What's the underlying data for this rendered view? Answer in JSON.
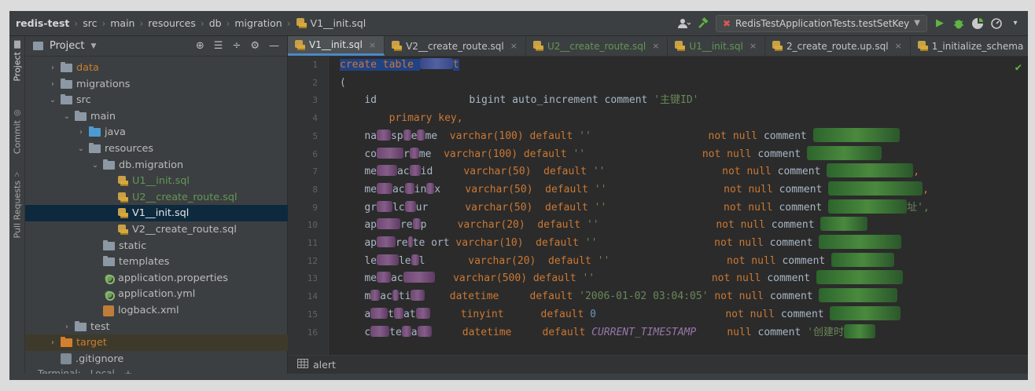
{
  "breadcrumb": {
    "items": [
      "redis-test",
      "src",
      "main",
      "resources",
      "db",
      "migration"
    ],
    "file": "V1__init.sql"
  },
  "run_config": {
    "label": "RedisTestApplicationTests.testSetKey"
  },
  "left_stripe": {
    "tabs": [
      "Project",
      "Commit",
      "Pull Requests"
    ]
  },
  "project_panel": {
    "title": "Project",
    "tree": [
      {
        "label": "data",
        "kind": "folder",
        "arrow": "›",
        "color": "orange"
      },
      {
        "label": "migrations",
        "kind": "folder",
        "arrow": "›",
        "color": ""
      },
      {
        "label": "src",
        "kind": "folder",
        "arrow": "⌄",
        "color": ""
      },
      {
        "label": "main",
        "kind": "folder",
        "arrow": "⌄",
        "color": ""
      },
      {
        "label": "java",
        "kind": "folder-blue",
        "arrow": "›",
        "color": ""
      },
      {
        "label": "resources",
        "kind": "folder",
        "arrow": "⌄",
        "color": ""
      },
      {
        "label": "db.migration",
        "kind": "folder",
        "arrow": "⌄",
        "color": ""
      },
      {
        "label": "U1__init.sql",
        "kind": "sql",
        "arrow": "",
        "color": "green"
      },
      {
        "label": "U2__create_route.sql",
        "kind": "sql",
        "arrow": "",
        "color": "green"
      },
      {
        "label": "V1__init.sql",
        "kind": "sql",
        "arrow": "",
        "color": "white"
      },
      {
        "label": "V2__create_route.sql",
        "kind": "sql",
        "arrow": "",
        "color": ""
      },
      {
        "label": "static",
        "kind": "folder",
        "arrow": "",
        "color": ""
      },
      {
        "label": "templates",
        "kind": "folder",
        "arrow": "",
        "color": ""
      },
      {
        "label": "application.properties",
        "kind": "props",
        "arrow": "",
        "color": ""
      },
      {
        "label": "application.yml",
        "kind": "props",
        "arrow": "",
        "color": ""
      },
      {
        "label": "logback.xml",
        "kind": "xml",
        "arrow": "",
        "color": ""
      },
      {
        "label": "test",
        "kind": "folder",
        "arrow": "›",
        "color": ""
      },
      {
        "label": "target",
        "kind": "folder-orange",
        "arrow": "›",
        "color": "orange"
      },
      {
        "label": ".gitignore",
        "kind": "git",
        "arrow": "",
        "color": ""
      }
    ],
    "terminal": {
      "label": "Terminal:",
      "session": "Local"
    }
  },
  "tabs": [
    {
      "label": "V1__init.sql",
      "active": true,
      "color": ""
    },
    {
      "label": "V2__create_route.sql",
      "active": false,
      "color": ""
    },
    {
      "label": "U2__create_route.sql",
      "active": false,
      "color": "green"
    },
    {
      "label": "U1__init.sql",
      "active": false,
      "color": "green"
    },
    {
      "label": "2_create_route.up.sql",
      "active": false,
      "color": ""
    },
    {
      "label": "1_initialize_schema",
      "active": false,
      "color": ""
    }
  ],
  "editor": {
    "line_numbers": [
      "1",
      "2",
      "3",
      "4",
      "5",
      "6",
      "7",
      "8",
      "9",
      "10",
      "11",
      "12",
      "13",
      "14",
      "15",
      "16"
    ],
    "code": {
      "create": "create",
      "table": "table",
      "open_paren": "(",
      "id_col": "id",
      "id_type": "bigint auto_increment comment",
      "id_comment": "'主键ID'",
      "primary_key": "primary key,",
      "default": "default",
      "empty_str": "''",
      "not_null": "not null",
      "null": "null",
      "comment": "comment",
      "varchar_100": "varchar(100)",
      "varchar_50": "varchar(50)",
      "varchar_20": "varchar(20)",
      "varchar_10": "varchar(10)",
      "varchar_500": "varchar(500)",
      "datetime": "datetime",
      "tinyint": "tinyint",
      "default_datetime": "'2006-01-02 03:04:05'",
      "default_zero": "0",
      "current_ts": "CURRENT_TIMESTAMP",
      "comment_last": "'创建时"
    },
    "col_fragments": {
      "l5": [
        "na",
        "sp",
        "e",
        "me"
      ],
      "l6": [
        "co",
        "r",
        "me"
      ],
      "l7": [
        "me",
        "ac",
        "id"
      ],
      "l8": [
        "me",
        "ac",
        "in",
        "x"
      ],
      "l9": [
        "gr",
        "lc",
        "ur"
      ],
      "l10": [
        "ap",
        "re",
        "p"
      ],
      "l11": [
        "ap",
        "re",
        "te",
        "ort"
      ],
      "l12": [
        "le",
        "le",
        "l"
      ],
      "l13": [
        "me",
        "ac"
      ],
      "l14": [
        "m",
        "ac",
        "ti"
      ],
      "l15": [
        "a",
        "t",
        "at"
      ],
      "l16": [
        "c",
        "te",
        "a"
      ]
    },
    "trail_comma": ",",
    "trail_cn": "址',"
  },
  "editor_breadcrumb": {
    "label": "alert"
  }
}
